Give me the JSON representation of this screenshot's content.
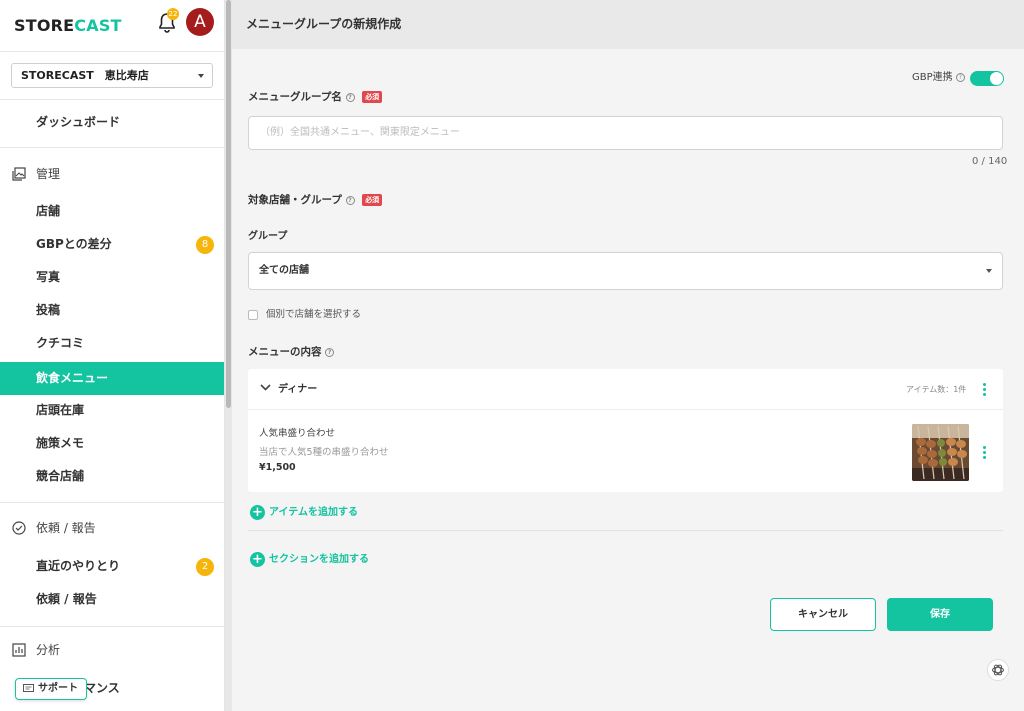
{
  "sidebar": {
    "brand_part1": "STORE",
    "brand_part2": "CAST",
    "notification_count": "22",
    "avatar_initial": "A",
    "store_selector": "STORECAST　恵比寿店",
    "dashboard": "ダッシュボード",
    "section_manage": "管理",
    "items_manage": [
      "店舗",
      "GBPとの差分",
      "写真",
      "投稿",
      "クチコミ",
      "飲食メニュー",
      "店頭在庫",
      "施策メモ",
      "競合店舗"
    ],
    "gbp_diff_badge": "8",
    "section_requests": "依頼 / 報告",
    "items_requests": [
      "直近のやりとり",
      "依頼 / 報告"
    ],
    "recent_badge": "2",
    "section_analysis": "分析",
    "items_analysis": [
      "パフォーマンス"
    ],
    "support_label": "サポート"
  },
  "header": {
    "title": "メニューグループの新規作成"
  },
  "form": {
    "gbp_sync_label": "GBP連携",
    "gbp_sync_on": true,
    "group_name_label": "メニューグループ名",
    "required_badge": "必須",
    "group_name_placeholder": "（例）全国共通メニュー、関東限定メニュー",
    "char_counter": "0 / 140",
    "target_label": "対象店舗・グループ",
    "group_label": "グループ",
    "group_selected": "全ての店舗",
    "individual_select_label": "個別で店舗を選択する",
    "menu_content_label": "メニューの内容"
  },
  "menu_section": {
    "name": "ディナー",
    "item_count": "アイテム数：1件",
    "item": {
      "name": "人気串盛り合わせ",
      "description": "当店で人気5種の串盛り合わせ",
      "price": "¥1,500"
    },
    "add_item": "アイテムを追加する",
    "add_section": "セクションを追加する"
  },
  "actions": {
    "cancel": "キャンセル",
    "save": "保存"
  },
  "colors": {
    "accent": "#14c3a0",
    "badge": "#f5b50a",
    "required": "#e0484d",
    "avatar": "#a51c1c"
  }
}
